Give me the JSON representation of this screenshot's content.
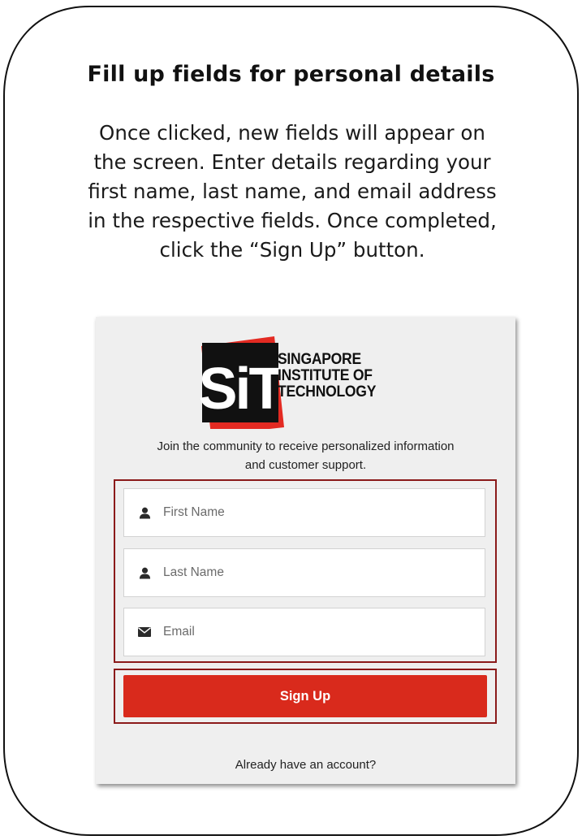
{
  "heading": "Fill up fields for personal details",
  "instructions": [
    "Once clicked, new fields will appear on",
    "the screen. Enter details regarding your",
    "first name, last name, and email address",
    "in the respective fields. Once completed,",
    "click the “Sign Up” button."
  ],
  "signup_card": {
    "logo": {
      "mark": "SiT",
      "name_lines": [
        "SINGAPORE",
        "INSTITUTE OF",
        "TECHNOLOGY"
      ]
    },
    "intro_lines": [
      "Join the community to receive personalized information",
      "and customer support."
    ],
    "fields": [
      {
        "placeholder": "First Name",
        "icon": "user-icon"
      },
      {
        "placeholder": "Last Name",
        "icon": "user-icon"
      },
      {
        "placeholder": "Email",
        "icon": "envelope-icon"
      }
    ],
    "submit_label": "Sign Up",
    "footer_text": "Already have an account?"
  },
  "colors": {
    "accent_red": "#d92a1c",
    "highlight_border": "#8b1a1a",
    "card_background": "#efefef"
  }
}
